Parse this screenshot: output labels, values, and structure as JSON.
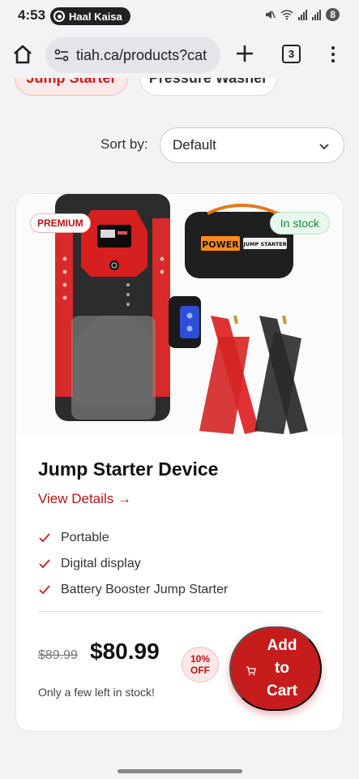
{
  "status_bar": {
    "time": "4:53",
    "notification": "Haal Kaisa",
    "battery": "8"
  },
  "browser": {
    "url": "tiah.ca/products?cat",
    "tab_count": "3"
  },
  "categories": [
    {
      "label": "Jump Starter",
      "active": true
    },
    {
      "label": "Pressure Washer",
      "active": false
    }
  ],
  "sort": {
    "label": "Sort by:",
    "selected": "Default"
  },
  "product": {
    "badge_premium": "PREMIUM",
    "badge_stock": "In stock",
    "image_text_power": "POWER",
    "image_text_brand": "JUMP STARTER",
    "title": "Jump Starter Device",
    "view_details": "View Details →",
    "features": [
      "Portable",
      "Digital display",
      "Battery Booster Jump Starter"
    ],
    "old_price": "$89.99",
    "price": "$80.99",
    "discount_percent": "10%",
    "discount_off": "OFF",
    "stock_note": "Only a few left in stock!",
    "add_to_cart": "Add to Cart"
  },
  "colors": {
    "accent": "#c71c1c",
    "stock_green": "#178a3b",
    "background": "#f3f3f5"
  }
}
